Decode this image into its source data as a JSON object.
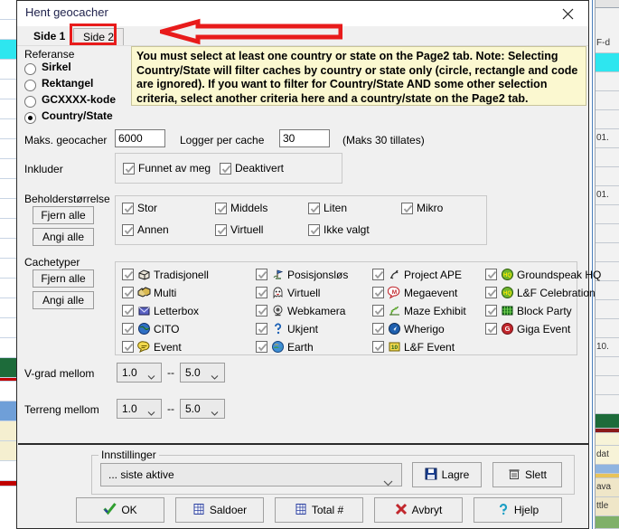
{
  "window": {
    "title": "Hent geocacher",
    "close_icon": "close-icon"
  },
  "tabs": [
    {
      "label": "Side 1",
      "active": true
    },
    {
      "label": "Side 2",
      "active": false
    }
  ],
  "annotation": {
    "arrow_color": "#e81b1b",
    "box_color": "#e81b1b",
    "points_to": "Side 2"
  },
  "notice": {
    "text": "You must select at least one country or state on the Page2 tab. Note: Selecting Country/State will filter caches by country or state only (circle, rectangle and code are ignored). If you want to filter for Country/State AND some other selection criteria, select another criteria here and a country/state on the Page2 tab.",
    "background": "#fbf8d0"
  },
  "reference": {
    "label": "Referanse",
    "options": [
      {
        "label": "Sirkel",
        "selected": false
      },
      {
        "label": "Rektangel",
        "selected": false
      },
      {
        "label": "GCXXXX-kode",
        "selected": false
      },
      {
        "label": "Country/State",
        "selected": true
      }
    ]
  },
  "fields": {
    "max_caches_label": "Maks. geocacher",
    "max_caches_value": "6000",
    "logs_label": "Logger per cache",
    "logs_value": "30",
    "logs_hint": "(Maks 30 tillates)"
  },
  "include": {
    "label": "Inkluder",
    "items": [
      {
        "label": "Funnet av meg",
        "checked": true
      },
      {
        "label": "Deaktivert",
        "checked": true
      }
    ]
  },
  "container_size": {
    "label": "Beholderstørrelse",
    "clear_button": "Fjern alle",
    "set_button": "Angi alle",
    "items": [
      {
        "label": "Stor",
        "checked": true
      },
      {
        "label": "Middels",
        "checked": true
      },
      {
        "label": "Liten",
        "checked": true
      },
      {
        "label": "Mikro",
        "checked": true
      },
      {
        "label": "Annen",
        "checked": true
      },
      {
        "label": "Virtuell",
        "checked": true
      },
      {
        "label": "Ikke valgt",
        "checked": true
      }
    ]
  },
  "cache_types": {
    "label": "Cachetyper",
    "clear_button": "Fjern alle",
    "set_button": "Angi alle",
    "columns": [
      [
        {
          "label": "Tradisjonell",
          "checked": true,
          "icon": "traditional-cache-icon"
        },
        {
          "label": "Multi",
          "checked": true,
          "icon": "multi-cache-icon"
        },
        {
          "label": "Letterbox",
          "checked": true,
          "icon": "letterbox-icon"
        },
        {
          "label": "CITO",
          "checked": true,
          "icon": "cito-icon"
        },
        {
          "label": "Event",
          "checked": true,
          "icon": "event-icon"
        }
      ],
      [
        {
          "label": "Posisjonsløs",
          "checked": true,
          "icon": "locationless-icon"
        },
        {
          "label": "Virtuell",
          "checked": true,
          "icon": "virtual-cache-icon"
        },
        {
          "label": "Webkamera",
          "checked": true,
          "icon": "webcam-icon"
        },
        {
          "label": "Ukjent",
          "checked": true,
          "icon": "mystery-cache-icon"
        },
        {
          "label": "Earth",
          "checked": true,
          "icon": "earthcache-icon"
        }
      ],
      [
        {
          "label": "Project APE",
          "checked": true,
          "icon": "project-ape-icon"
        },
        {
          "label": "Megaevent",
          "checked": true,
          "icon": "megaevent-icon"
        },
        {
          "label": "Maze Exhibit",
          "checked": true,
          "icon": "maze-exhibit-icon"
        },
        {
          "label": "Wherigo",
          "checked": true,
          "icon": "wherigo-icon"
        },
        {
          "label": "L&F Event",
          "checked": true,
          "icon": "lf-event-icon"
        }
      ],
      [
        {
          "label": "Groundspeak HQ",
          "checked": true,
          "icon": "groundspeak-hq-icon"
        },
        {
          "label": "L&F Celebration",
          "checked": true,
          "icon": "lf-celebration-icon"
        },
        {
          "label": "Block Party",
          "checked": true,
          "icon": "block-party-icon"
        },
        {
          "label": "Giga Event",
          "checked": true,
          "icon": "giga-event-icon"
        }
      ]
    ]
  },
  "ranges": {
    "difficulty_label": "V-grad mellom",
    "difficulty_from": "1.0",
    "difficulty_to": "5.0",
    "terrain_label": "Terreng mellom",
    "terrain_from": "1.0",
    "terrain_to": "5.0",
    "separator": "--"
  },
  "settings": {
    "legend": "Innstillinger",
    "preset_value": "... siste aktive",
    "save_button": "Lagre",
    "save_icon": "floppy-disk-icon",
    "delete_button": "Slett",
    "delete_icon": "trash-icon"
  },
  "actions": [
    {
      "label": "OK",
      "icon": "checkmark-icon"
    },
    {
      "label": "Saldoer",
      "icon": "grid-document-icon"
    },
    {
      "label": "Total #",
      "icon": "grid-document-icon"
    },
    {
      "label": "Avbryt",
      "icon": "red-x-icon"
    },
    {
      "label": "Hjelp",
      "icon": "question-mark-icon"
    }
  ],
  "background": {
    "right_cells": [
      "F-d",
      "",
      "",
      "",
      "",
      "01.",
      "",
      "",
      "01.",
      "",
      "",
      "",
      "",
      "",
      "",
      "",
      "10."
    ],
    "right_bottom_cells": [
      "dat",
      "",
      "ava",
      "ttle"
    ]
  }
}
